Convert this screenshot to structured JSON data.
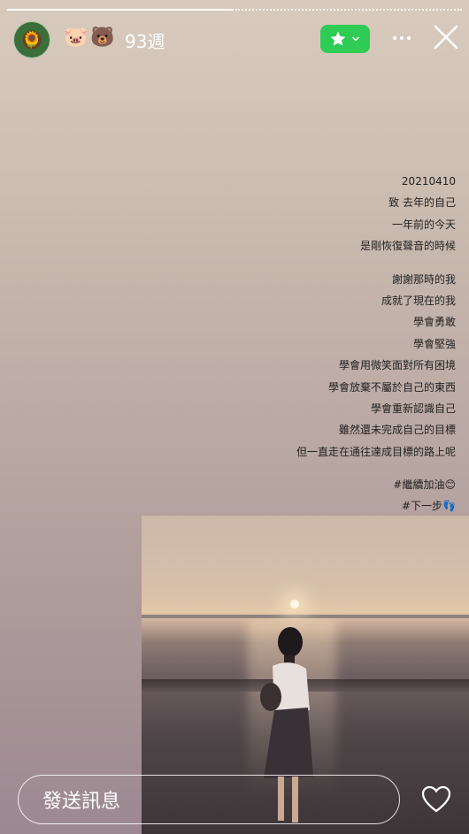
{
  "header": {
    "avatar_icon": "sunflower-avatar",
    "emoji_1": "🐷",
    "emoji_2": "🐻",
    "weeks": "93週",
    "accent_color": "#2fcc55"
  },
  "post": {
    "lines_1": [
      "20210410",
      "致 去年的自己",
      "一年前的今天",
      "是剛恢復聲音的時候"
    ],
    "lines_2": [
      "謝謝那時的我",
      "成就了現在的我",
      "學會勇敢",
      "學會堅強",
      "學會用微笑面對所有困境",
      "學會放棄不屬於自己的東西",
      "學會重新認識自己",
      "雖然還未完成自己的目標",
      "但一直走在通往達成目標的路上呢"
    ],
    "tags": [
      "#繼續加油😊",
      "#下一步👣"
    ]
  },
  "footer": {
    "message_placeholder": "發送訊息"
  }
}
